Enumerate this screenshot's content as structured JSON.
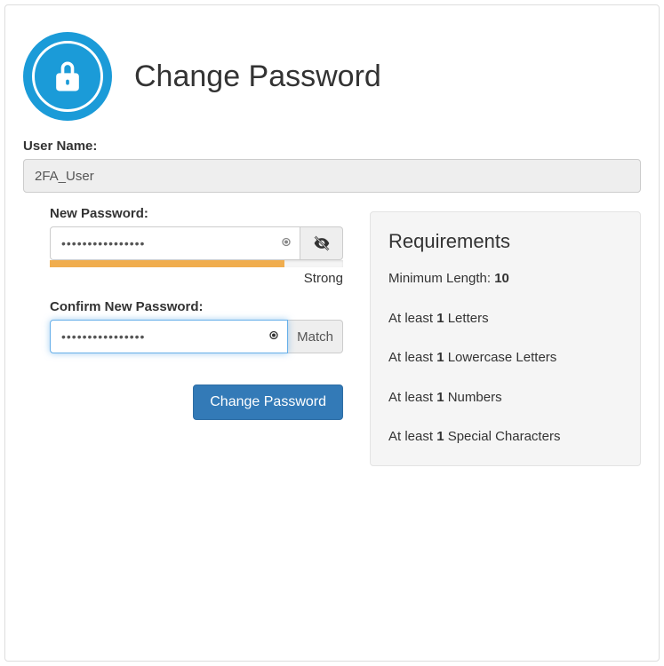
{
  "header": {
    "title": "Change Password"
  },
  "form": {
    "username_label": "User Name:",
    "username_value": "2FA_User",
    "new_password_label": "New Password:",
    "new_password_value": "••••••••••••••••",
    "strength_percent": 80,
    "strength_text": "Strong",
    "confirm_password_label": "Confirm New Password:",
    "confirm_password_value": "••••••••••••••••",
    "match_text": "Match",
    "submit_label": "Change Password"
  },
  "requirements": {
    "title": "Requirements",
    "min_length_prefix": "Minimum Length: ",
    "min_length_value": "10",
    "items": [
      {
        "prefix": "At least ",
        "count": "1",
        "suffix": " Letters"
      },
      {
        "prefix": "At least ",
        "count": "1",
        "suffix": " Lowercase Letters"
      },
      {
        "prefix": "At least ",
        "count": "1",
        "suffix": " Numbers"
      },
      {
        "prefix": "At least ",
        "count": "1",
        "suffix": " Special Characters"
      }
    ]
  },
  "colors": {
    "accent": "#1b9bd8",
    "primary_btn": "#337ab7",
    "strength": "#f0ad4e"
  }
}
